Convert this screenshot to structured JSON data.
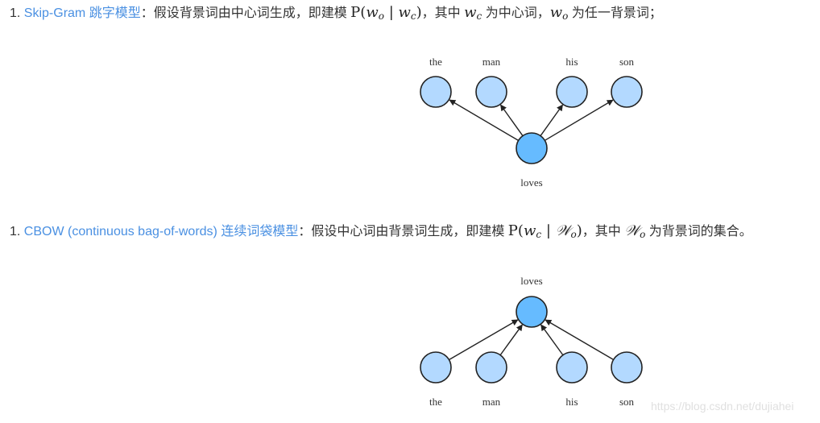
{
  "skipgram": {
    "number": "1.",
    "link_text": "Skip-Gram 跳字模型",
    "text_before_math": "：假设背景词由中心词生成，即建模 ",
    "math_prob": {
      "P": "P",
      "open": "(",
      "w1": "w",
      "w1_sub": "o",
      "bar": " | ",
      "w2": "w",
      "w2_sub": "c",
      "close": ")"
    },
    "text_mid1": "，其中 ",
    "math_wc": {
      "w": "w",
      "sub": "c"
    },
    "text_mid2": " 为中心词，",
    "math_wo": {
      "w": "w",
      "sub": "o"
    },
    "text_end": " 为任一背景词；",
    "diagram": {
      "context_words": [
        "the",
        "man",
        "his",
        "son"
      ],
      "center_word": "loves",
      "edge_direction": "center-to-context"
    }
  },
  "cbow": {
    "number": "1.",
    "link_text": "CBOW (continuous bag-of-words) 连续词袋模型",
    "text_before_math": "：假设中心词由背景词生成，即建模 ",
    "math_prob": {
      "P": "P",
      "open": "(",
      "w1": "w",
      "w1_sub": "c",
      "bar": " | ",
      "w2": "𝒲",
      "w2_sub": "o",
      "close": ")"
    },
    "text_mid1": "，其中 ",
    "math_Wo": {
      "w": "𝒲",
      "sub": "o"
    },
    "text_end": " 为背景词的集合。",
    "diagram": {
      "context_words": [
        "the",
        "man",
        "his",
        "son"
      ],
      "center_word": "loves",
      "edge_direction": "context-to-center"
    }
  },
  "colors": {
    "link": "#4a90e2",
    "context_node_fill": "#b3d9ff",
    "center_node_fill": "#66bbff",
    "node_stroke": "#222222"
  },
  "watermark": "https://blog.csdn.net/dujiahei"
}
